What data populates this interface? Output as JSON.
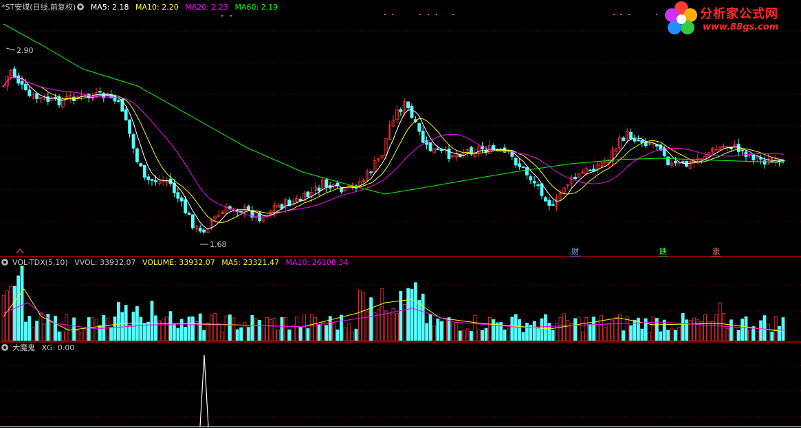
{
  "main_panel": {
    "title": "*ST安煤(日线,前复权)",
    "ma5": "MA5: 2.18",
    "ma10": "MA10: 2.20",
    "ma20": "MA20: 2.23",
    "ma60": "MA60: 2.19",
    "high_label": "2.90",
    "low_label": "1.68",
    "badges": [
      "财",
      "跌",
      "涨"
    ]
  },
  "volume_panel": {
    "title": "VOL-TDX(5,10)",
    "vvol": "VVOL: 33932.07",
    "volume": "VOLUME: 33932.07",
    "ma5": "MA5: 23321.47",
    "ma10": "MA10: 26108.34"
  },
  "indicator_panel": {
    "title": "大魔鬼",
    "xg": "XG: 0.00"
  },
  "logo": {
    "name": "分析家公式网",
    "url": "www.88gs.com"
  },
  "colors": {
    "up": "#ff3232",
    "down": "#54ffff",
    "ma5": "#ffffff",
    "ma10": "#ffff00",
    "ma20": "#ff00ff",
    "ma60": "#00ff00",
    "grid": "#8b0000",
    "separator": "#b00000"
  }
}
